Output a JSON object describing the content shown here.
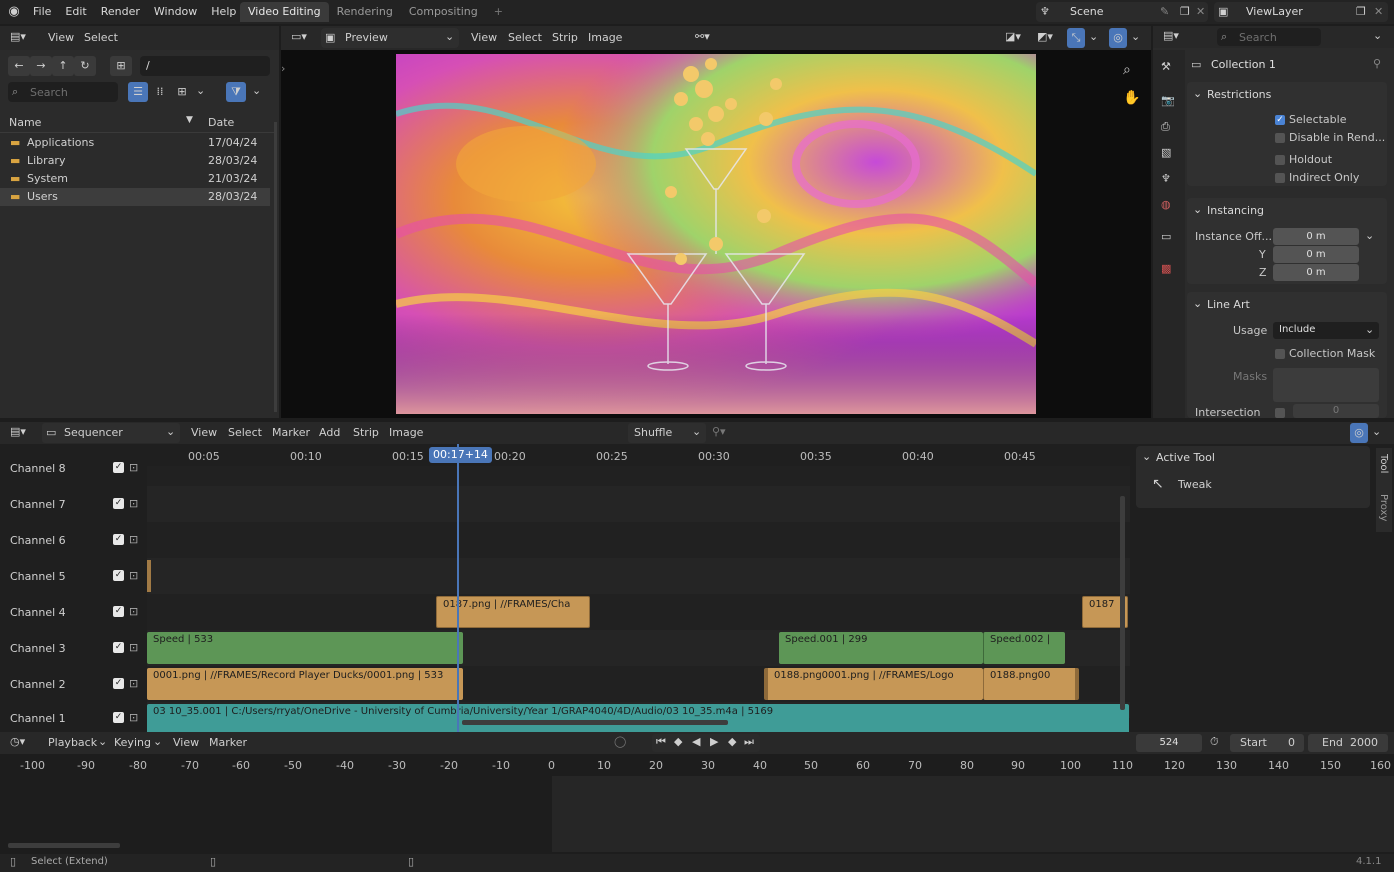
{
  "topbar": {
    "menus": [
      "File",
      "Edit",
      "Render",
      "Window",
      "Help"
    ],
    "workspaces": [
      "Video Editing",
      "Rendering",
      "Compositing"
    ],
    "scene": "Scene",
    "view_layer": "ViewLayer"
  },
  "file_browser": {
    "menus": [
      "View",
      "Select"
    ],
    "path": "/",
    "search_placeholder": "Search",
    "col_name": "Name",
    "col_date": "Date",
    "rows": [
      {
        "name": "Applications",
        "date": "17/04/24"
      },
      {
        "name": "Library",
        "date": "28/03/24"
      },
      {
        "name": "System",
        "date": "21/03/24"
      },
      {
        "name": "Users",
        "date": "28/03/24"
      }
    ]
  },
  "preview": {
    "mode": "Preview",
    "menus": [
      "View",
      "Select",
      "Strip",
      "Image"
    ]
  },
  "properties": {
    "search_placeholder": "Search",
    "collection": "Collection 1",
    "restrictions": {
      "title": "Restrictions",
      "selectable": "Selectable",
      "disable_render": "Disable in Rend...",
      "holdout": "Holdout",
      "indirect_only": "Indirect Only"
    },
    "instancing": {
      "title": "Instancing",
      "offset_label": "Instance Off...",
      "x": "0 m",
      "y_label": "Y",
      "y": "0 m",
      "z_label": "Z",
      "z": "0 m"
    },
    "line_art": {
      "title": "Line Art",
      "usage_label": "Usage",
      "usage_value": "Include",
      "collection_mask": "Collection Mask",
      "masks_label": "Masks",
      "intersection_label": "Intersection",
      "intersection_value": "0"
    }
  },
  "sequencer": {
    "editor": "Sequencer",
    "menus": [
      "View",
      "Select",
      "Marker",
      "Add",
      "Strip",
      "Image"
    ],
    "overlap_mode": "Shuffle",
    "ruler": [
      "00:05",
      "00:10",
      "00:15",
      "00:20",
      "00:25",
      "00:30",
      "00:35",
      "00:40",
      "00:45"
    ],
    "current_time": "00:17+14",
    "channels": [
      "Channel 8",
      "Channel 7",
      "Channel 6",
      "Channel 5",
      "Channel 4",
      "Channel 3",
      "Channel 2",
      "Channel 1"
    ],
    "strips": {
      "ch4_a": "0187.png | //FRAMES/Cha",
      "ch4_b": "0187",
      "ch3_a": "Speed | 533",
      "ch3_b": "Speed.001 | 299",
      "ch3_c": "Speed.002 |",
      "ch2_a": "0001.png | //FRAMES/Record Player Ducks/0001.png | 533",
      "ch2_b": "0188.png0001.png | //FRAMES/Logo",
      "ch2_c": "0188.png00",
      "ch1": "03 10_35.001 | C:/Users/rryat/OneDrive - University of Cumbria/University/Year 1/GRAP4040/4D/Audio/03 10_35.m4a | 5169"
    },
    "side_panel": {
      "title": "Active Tool",
      "tool": "Tweak",
      "tabs": [
        "Tool",
        "Proxy"
      ]
    }
  },
  "timeline": {
    "menus": [
      "Playback",
      "Keying",
      "View",
      "Marker"
    ],
    "current_frame": "524",
    "start_label": "Start",
    "start": "0",
    "end_label": "End",
    "end": "2000",
    "ruler": [
      "-100",
      "-90",
      "-80",
      "-70",
      "-60",
      "-50",
      "-40",
      "-30",
      "-20",
      "-10",
      "0",
      "10",
      "20",
      "30",
      "40",
      "50",
      "60",
      "70",
      "80",
      "90",
      "100",
      "110",
      "120",
      "130",
      "140",
      "150",
      "160"
    ]
  },
  "statusbar": {
    "hint": "Select (Extend)",
    "version": "4.1.1"
  }
}
